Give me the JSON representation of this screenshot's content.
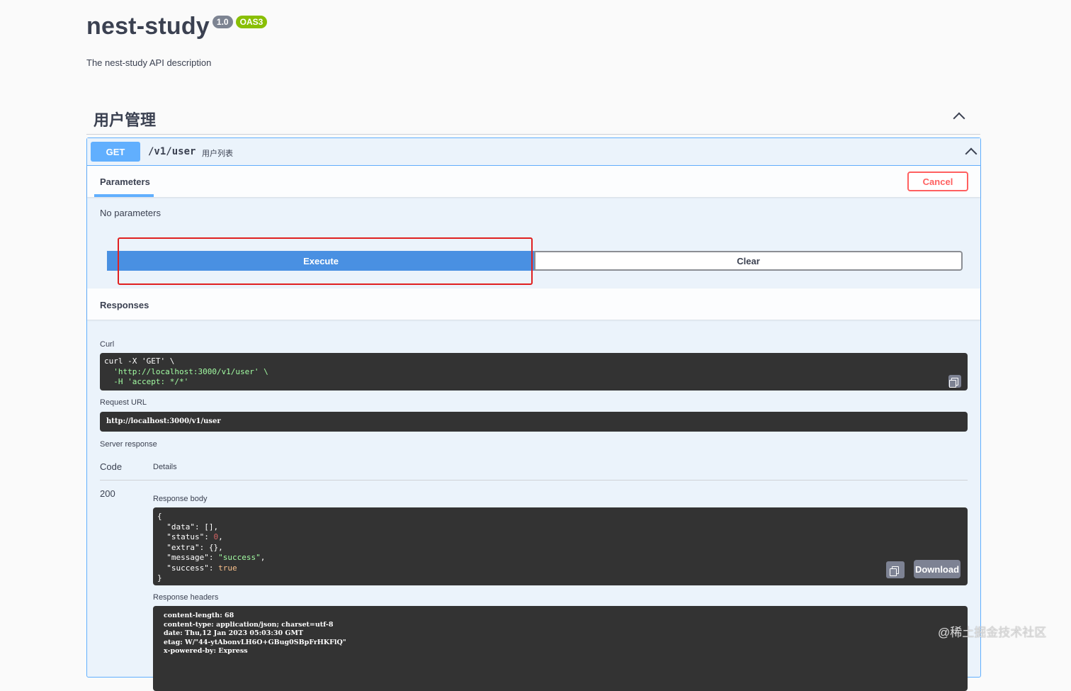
{
  "info": {
    "title": "nest-study",
    "version": "1.0",
    "oas": "OAS3",
    "description": "The nest-study API description"
  },
  "tag": {
    "name": "用户管理"
  },
  "operation": {
    "method": "GET",
    "path": "/v1/user",
    "summary": "用户列表"
  },
  "parameters": {
    "tab_label": "Parameters",
    "cancel_label": "Cancel",
    "empty_text": "No parameters"
  },
  "actions": {
    "execute_label": "Execute",
    "clear_label": "Clear"
  },
  "responses": {
    "title": "Responses",
    "curl_label": "Curl",
    "curl_line1": "curl -X 'GET' \\",
    "curl_line2": "  'http://localhost:3000/v1/user' \\",
    "curl_line3": "  -H 'accept: */*'",
    "request_url_label": "Request URL",
    "request_url": "http://localhost:3000/v1/user",
    "server_response_label": "Server response",
    "code_header": "Code",
    "details_header": "Details",
    "status_code": "200",
    "body_label": "Response body",
    "body_lines": {
      "open": "{",
      "data_key": "  \"data\": ",
      "data_val": "[]",
      "status_key": "  \"status\": ",
      "status_val": "0",
      "extra_key": "  \"extra\": ",
      "extra_val": "{}",
      "message_key": "  \"message\": ",
      "message_val": "\"success\"",
      "success_key": "  \"success\": ",
      "success_val": "true",
      "close": "}"
    },
    "download_label": "Download",
    "headers_label": "Response headers",
    "headers_text": "content-length: 68\ncontent-type: application/json; charset=utf-8\ndate: Thu,12 Jan 2023 05:03:30 GMT\netag: W/\"44-ytAbonvLH6O+GBug0SBpFrHKFlQ\"\nx-powered-by: Express"
  },
  "watermark": "@稀土掘金技术社区"
}
